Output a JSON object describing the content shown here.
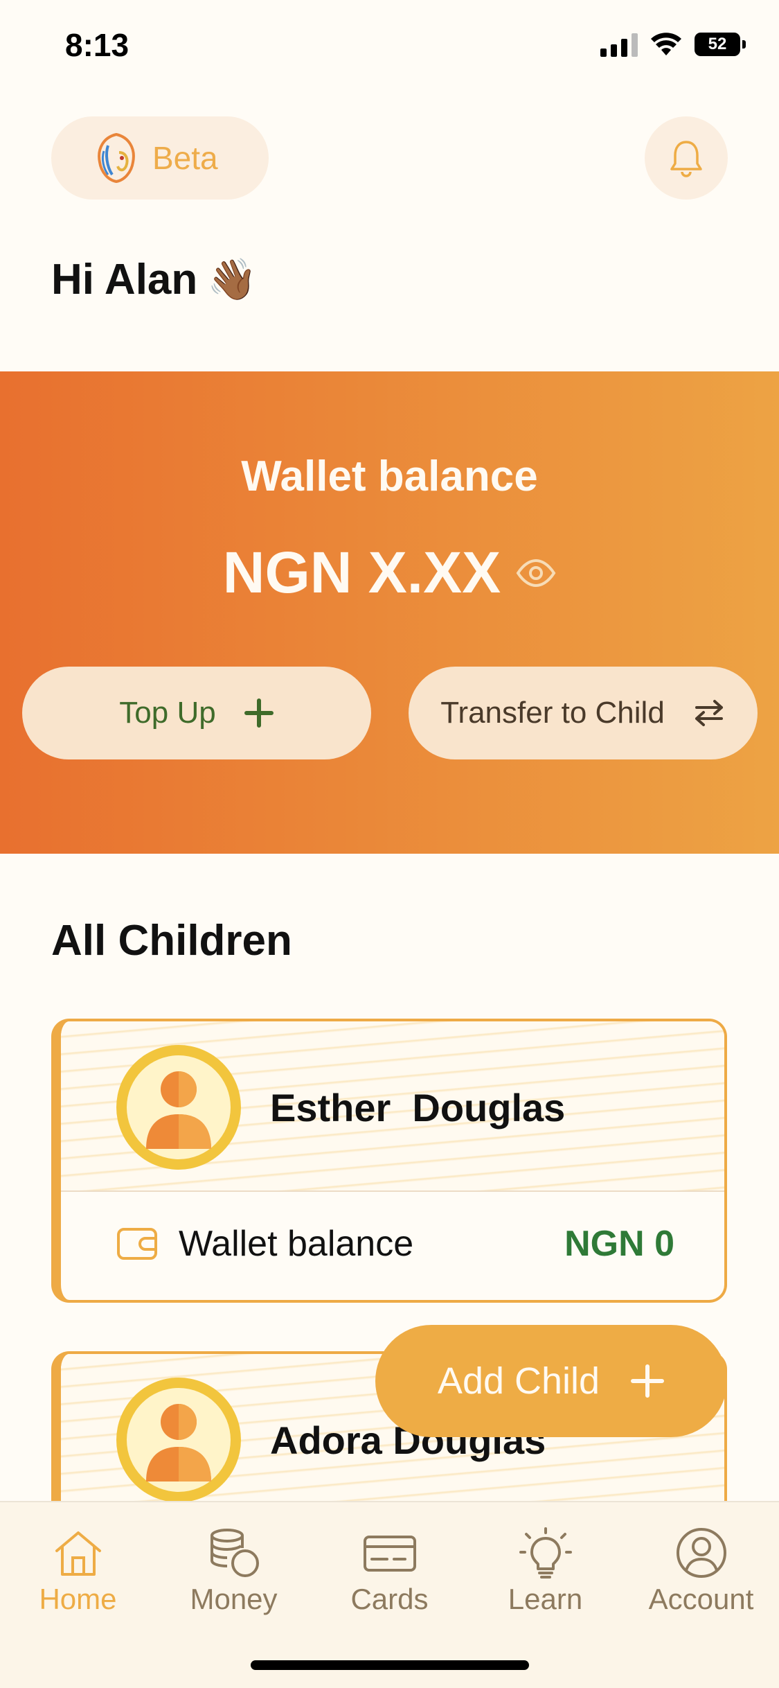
{
  "status_bar": {
    "time": "8:13",
    "battery": "52"
  },
  "header": {
    "beta_label": "Beta",
    "greeting": "Hi Alan",
    "greeting_emoji": "👋🏾"
  },
  "wallet": {
    "title": "Wallet balance",
    "amount": "NGN X.XX",
    "topup_label": "Top Up",
    "transfer_label": "Transfer to Child"
  },
  "children": {
    "title": "All Children",
    "items": [
      {
        "name": "Esther  Douglas",
        "wallet_label": "Wallet balance",
        "wallet_value": "NGN 0"
      },
      {
        "name": "Adora Douglas"
      }
    ],
    "add_child_label": "Add Child"
  },
  "tabs": [
    {
      "label": "Home",
      "icon": "home-icon",
      "active": true
    },
    {
      "label": "Money",
      "icon": "coins-icon"
    },
    {
      "label": "Cards",
      "icon": "card-icon"
    },
    {
      "label": "Learn",
      "icon": "bulb-icon"
    },
    {
      "label": "Account",
      "icon": "user-circle-icon"
    }
  ],
  "colors": {
    "accent": "#eeac45",
    "banner_start": "#e8702f",
    "banner_end": "#eda344",
    "green": "#2f7a37",
    "background": "#fffcf6"
  }
}
